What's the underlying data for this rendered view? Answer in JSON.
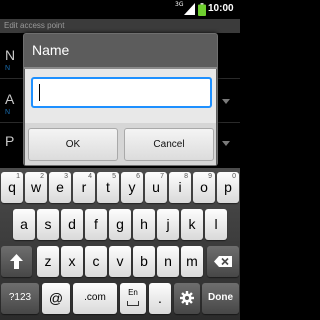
{
  "status_bar": {
    "network_type": "3G",
    "time": "10:00",
    "icons": [
      "signal-icon",
      "battery-icon"
    ]
  },
  "background": {
    "title": "Edit access point",
    "items": [
      {
        "letter": "N",
        "sub": "N"
      },
      {
        "letter": "A",
        "sub": "N"
      },
      {
        "letter": "P",
        "sub": ""
      }
    ]
  },
  "dialog": {
    "title": "Name",
    "input_value": "",
    "ok_label": "OK",
    "cancel_label": "Cancel"
  },
  "keyboard": {
    "row1": [
      {
        "ch": "q",
        "sup": "1"
      },
      {
        "ch": "w",
        "sup": "2"
      },
      {
        "ch": "e",
        "sup": "3"
      },
      {
        "ch": "r",
        "sup": "4"
      },
      {
        "ch": "t",
        "sup": "5"
      },
      {
        "ch": "y",
        "sup": "6"
      },
      {
        "ch": "u",
        "sup": "7"
      },
      {
        "ch": "i",
        "sup": "8"
      },
      {
        "ch": "o",
        "sup": "9"
      },
      {
        "ch": "p",
        "sup": "0"
      }
    ],
    "row2": [
      "a",
      "s",
      "d",
      "f",
      "g",
      "h",
      "j",
      "k",
      "l"
    ],
    "row3": [
      "z",
      "x",
      "c",
      "v",
      "b",
      "n",
      "m"
    ],
    "symbols_label": "?123",
    "at_label": "@",
    "com_label": ".com",
    "lang_label": "En",
    "period_label": ".",
    "done_label": "Done",
    "colors": {
      "accent": "#1e90ff",
      "battery": "#6fcf2f"
    }
  }
}
